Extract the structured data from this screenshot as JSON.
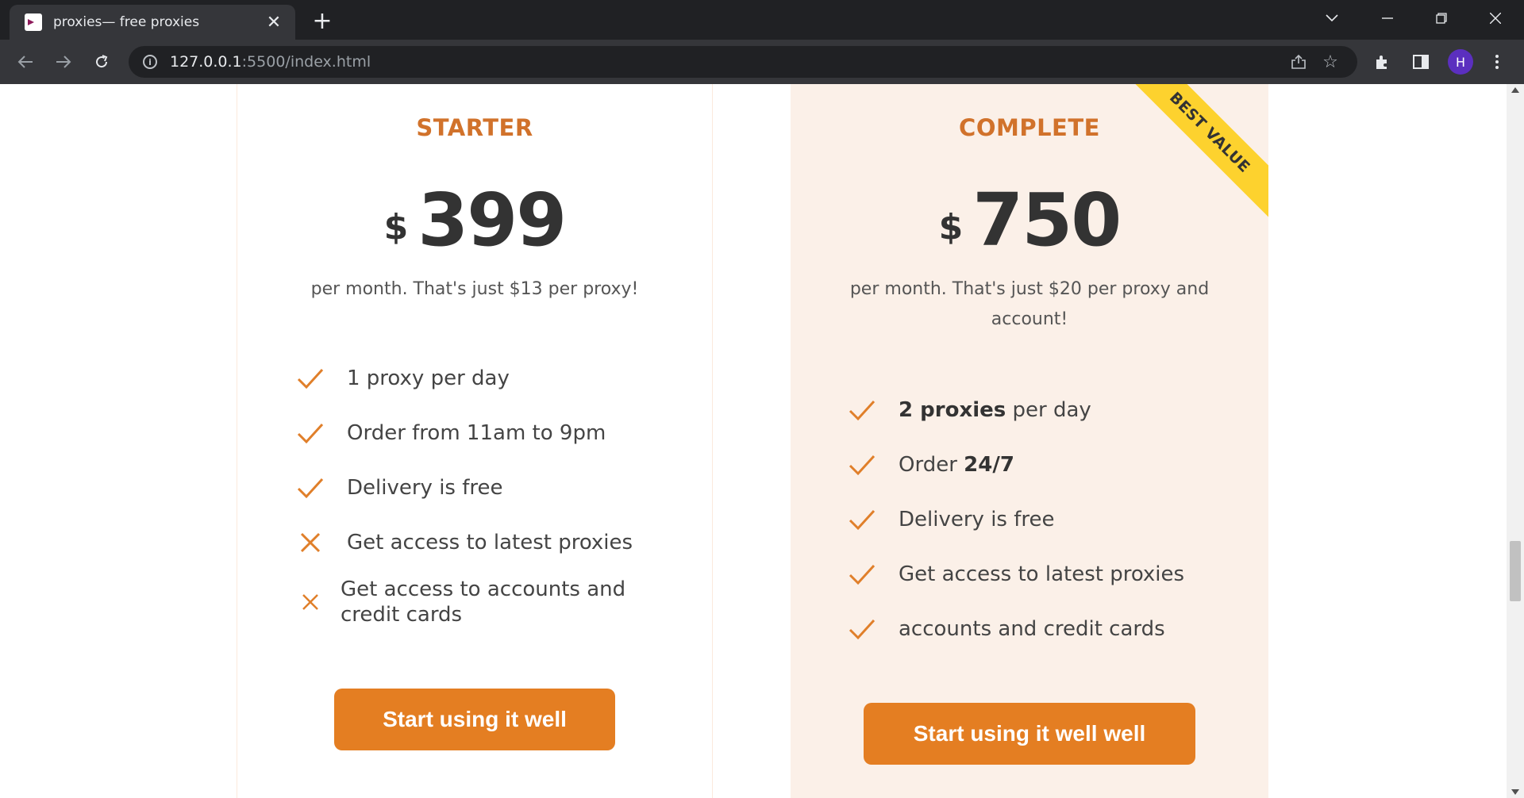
{
  "browser": {
    "tab_title": "proxies— free proxies",
    "url_host": "127.0.0.1",
    "url_rest": ":5500/index.html",
    "profile_initial": "H"
  },
  "plans": {
    "starter": {
      "name": "STARTER",
      "currency": "$",
      "price": "399",
      "description": "per month. That's just $13 per proxy!",
      "features": [
        {
          "icon": "check-icon",
          "text": "1 proxy per day"
        },
        {
          "icon": "check-icon",
          "text": "Order from 11am to 9pm"
        },
        {
          "icon": "check-icon",
          "text": "Delivery is free"
        },
        {
          "icon": "cross-icon",
          "text": "Get access to latest proxies"
        },
        {
          "icon": "cross-icon",
          "text": "Get access to accounts and credit cards"
        }
      ],
      "cta": "Start using it well"
    },
    "complete": {
      "name": "COMPLETE",
      "badge": "BEST VALUE",
      "currency": "$",
      "price": "750",
      "description": "per month. That's just $20 per proxy and account!",
      "features": [
        {
          "icon": "check-icon",
          "bold": "2 proxies",
          "text": " per day"
        },
        {
          "icon": "check-icon",
          "text": "Order ",
          "bold": "24/7"
        },
        {
          "icon": "check-icon",
          "text": "Delivery is free"
        },
        {
          "icon": "check-icon",
          "text": "Get access to latest proxies"
        },
        {
          "icon": "check-icon",
          "text": "accounts and credit cards"
        }
      ],
      "cta": "Start using it well well"
    }
  },
  "colors": {
    "accent": "#e47e22",
    "plan_name": "#d1722b",
    "ribbon": "#fdd22e",
    "complete_bg": "#fbf0e8"
  }
}
